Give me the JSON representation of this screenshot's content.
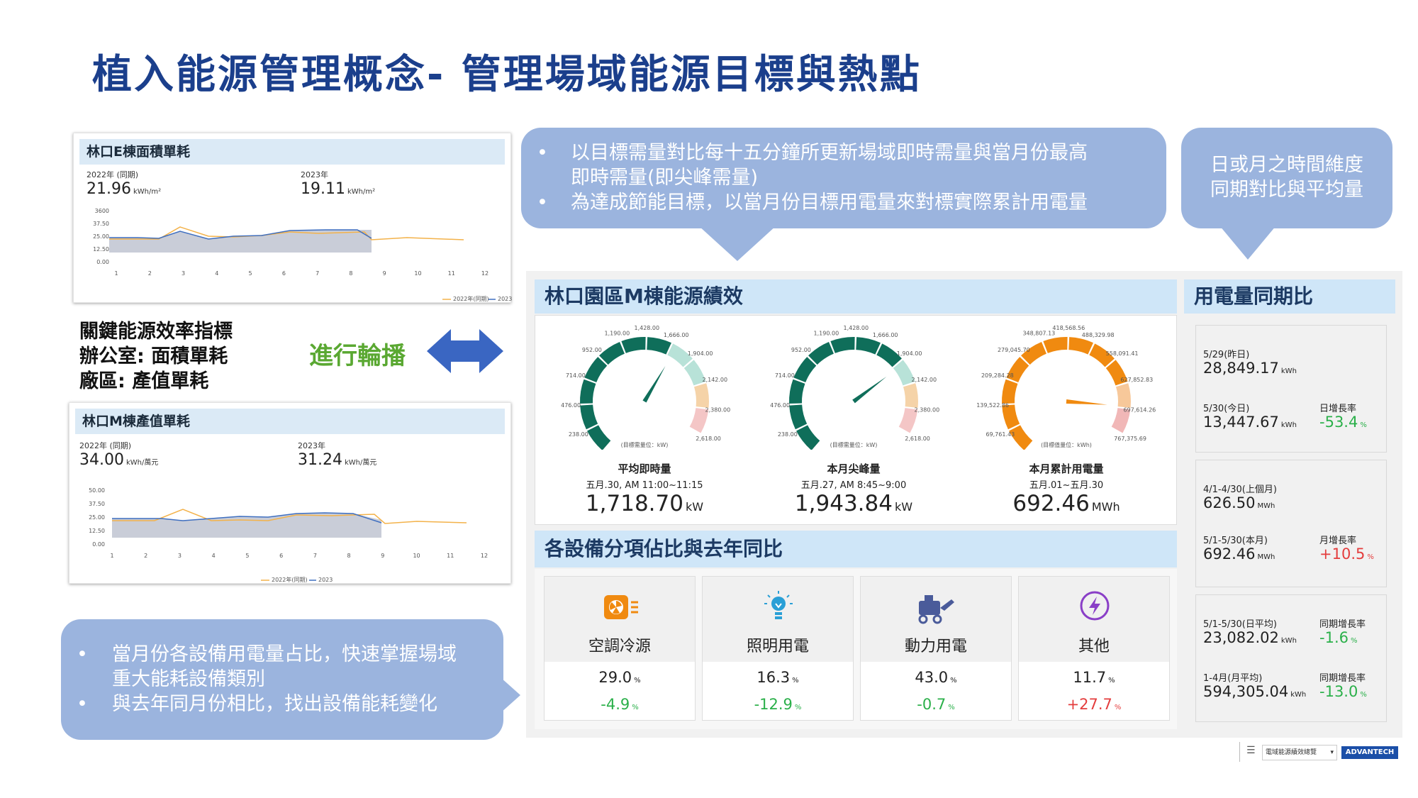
{
  "title": "植入能源管理概念- 管理場域能源目標與熱點",
  "panel_e": {
    "header": "林口E棟面積單耗",
    "left_label": "2022年 (同期)",
    "left_value": "21.96",
    "left_unit": "kWh/m²",
    "right_label": "2023年",
    "right_value": "19.11",
    "right_unit": "kWh/m²",
    "y_ticks": [
      "3600",
      "37.50",
      "25.00",
      "12.50",
      "0.00"
    ],
    "x_ticks": [
      "1",
      "2",
      "3",
      "4",
      "5",
      "6",
      "7",
      "8",
      "9",
      "10",
      "11",
      "12"
    ],
    "legend": [
      "2022年(同期)",
      "2023"
    ]
  },
  "panel_m": {
    "header": "林口M棟產值單耗",
    "left_label": "2022年 (同期)",
    "left_value": "34.00",
    "left_unit": "kWh/萬元",
    "right_label": "2023年",
    "right_value": "31.24",
    "right_unit": "kWh/萬元",
    "y_ticks": [
      "50.00",
      "37.50",
      "25.00",
      "12.50",
      "0.00"
    ],
    "x_ticks": [
      "1",
      "2",
      "3",
      "4",
      "5",
      "6",
      "7",
      "8",
      "9",
      "10",
      "11",
      "12"
    ],
    "legend": [
      "2022年(同期)",
      "2023"
    ]
  },
  "kpi": {
    "line1": "關鍵能源效率指標",
    "line2": "辦公室: 面積單耗",
    "line3": "廠區: 產值單耗"
  },
  "rotate_label": "進行輪播",
  "bubble_top": {
    "line1": "以目標需量對比每十五分鐘所更新場域即時需量與當月份最高",
    "line2": "即時需量(即尖峰需量)",
    "line3": "為達成節能目標，以當月份目標用電量來對標實際累計用電量"
  },
  "bubble_right": {
    "line1": "日或月之時間維度",
    "line2": "同期對比與平均量"
  },
  "bubble_bottom": {
    "line1": "當月份各設備用電量占比，快速掌握場域",
    "line2": "重大能耗設備類別",
    "line3": "與去年同月份相比，找出設備能耗變化"
  },
  "dashboard": {
    "perf_header": "林口園區M棟能源績效",
    "yoy_header": "用電量同期比",
    "device_header": "各設備分項佔比與去年同比",
    "gauges": [
      {
        "name": "平均即時量",
        "period": "五月.30, AM 11:00~11:15",
        "value": "1,718.70",
        "unit": "kW",
        "center_label": "(目標需量位：kW)",
        "scale": [
          "0",
          "238.00",
          "476.00",
          "714.00",
          "952.00",
          "1,190.00",
          "1,428.00",
          "1,666.00",
          "1,904.00",
          "2,142.00",
          "2,380.00",
          "2,618.00"
        ],
        "fraction": 0.656,
        "color": "#0f6e5a"
      },
      {
        "name": "本月尖峰量",
        "period": "五月.27, AM 8:45~9:00",
        "value": "1,943.84",
        "unit": "kW",
        "center_label": "(目標需量位：kW)",
        "scale": [
          "0",
          "238.00",
          "476.00",
          "714.00",
          "952.00",
          "1,190.00",
          "1,428.00",
          "1,666.00",
          "1,904.00",
          "2,142.00",
          "2,380.00",
          "2,618.00"
        ],
        "fraction": 0.742,
        "color": "#0f6e5a"
      },
      {
        "name": "本月累計用電量",
        "period": "五月.01~五月.30",
        "value": "692.46",
        "unit": "MWh",
        "center_label": "(目標值量位：kWh)",
        "scale": [
          "0",
          "69,761.43",
          "139,522.86",
          "209,284.28",
          "279,045.70",
          "348,807.13",
          "418,568.56",
          "488,329.98",
          "558,091.41",
          "627,852.83",
          "697,614.26",
          "767,375.69"
        ],
        "fraction": 0.902,
        "color": "#f08a10"
      }
    ],
    "devices": [
      {
        "name": "空調冷源",
        "pct": "29.0",
        "change": "-4.9",
        "icon": "hvac-icon",
        "status": "down"
      },
      {
        "name": "照明用電",
        "pct": "16.3",
        "change": "-12.9",
        "icon": "lightbulb-icon",
        "status": "down"
      },
      {
        "name": "動力用電",
        "pct": "43.0",
        "change": "-0.7",
        "icon": "motor-icon",
        "status": "down"
      },
      {
        "name": "其他",
        "pct": "11.7",
        "change": "+27.7",
        "icon": "lightning-icon",
        "status": "up"
      }
    ],
    "yoy": {
      "c1_l1": "5/29(昨日)",
      "c1_v1": "28,849.17",
      "c1_u1": "kWh",
      "c1_l2": "5/30(今日)",
      "c1_v2": "13,447.67",
      "c1_u2": "kWh",
      "c1_rl": "日增長率",
      "c1_rv": "-53.4",
      "c2_l1": "4/1-4/30(上個月)",
      "c2_v1": "626.50",
      "c2_u1": "MWh",
      "c2_l2": "5/1-5/30(本月)",
      "c2_v2": "692.46",
      "c2_u2": "MWh",
      "c2_rl": "月增長率",
      "c2_rv": "+10.5",
      "c3_l1": "5/1-5/30(日平均)",
      "c3_v1": "23,082.02",
      "c3_u1": "kWh",
      "c3_rl1": "同期增長率",
      "c3_rv1": "-1.6",
      "c3_l2": "1-4月(月平均)",
      "c3_v2": "594,305.04",
      "c3_u2": "kWh",
      "c3_rl2": "同期增長率",
      "c3_rv2": "-13.0"
    }
  },
  "footer": {
    "menu_icon": "menu-icon",
    "select_text": "電域能源績效總覽",
    "brand": "ADVANTECH"
  },
  "colors": {
    "title": "#1b3f8c",
    "bubble": "#9bb4de",
    "arrow": "#3a66c2",
    "rotate_text": "#5aa832",
    "gauge_teal": "#0f6e5a",
    "gauge_orange": "#f08a10",
    "green": "#2bb04a",
    "red": "#e43d3d"
  }
}
